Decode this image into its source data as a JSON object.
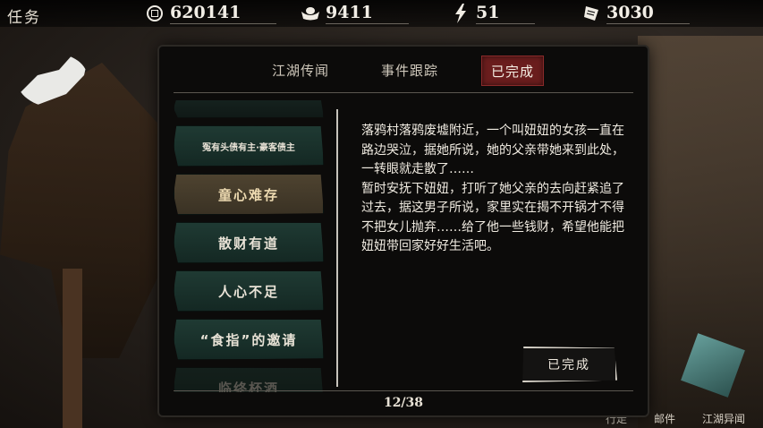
{
  "topbar": {
    "task_label": "任务",
    "resources": [
      {
        "icon": "coin-icon",
        "value": "620141"
      },
      {
        "icon": "silver-ingot-icon",
        "value": "9411"
      },
      {
        "icon": "lightning-icon",
        "value": "51"
      },
      {
        "icon": "scroll-icon",
        "value": "3030"
      }
    ]
  },
  "tabs": [
    {
      "label": "江湖传闻",
      "active": false
    },
    {
      "label": "事件跟踪",
      "active": false
    },
    {
      "label": "已完成",
      "active": true
    }
  ],
  "quest_list": [
    {
      "label": "冤有头债有主·豪客债主",
      "state": "normal"
    },
    {
      "label": "童心难存",
      "state": "active"
    },
    {
      "label": "散财有道",
      "state": "normal"
    },
    {
      "label": "人心不足",
      "state": "normal"
    },
    {
      "label": "“食指”的邀请",
      "state": "normal"
    },
    {
      "label": "临终杯酒",
      "state": "faded"
    }
  ],
  "description": "落鸦村落鸦废墟附近，一个叫妞妞的女孩一直在路边哭泣，据她所说，她的父亲带她来到此处，一转眼就走散了……\n暂时安抚下妞妞，打听了她父亲的去向赶紧追了过去，据这男子所说，家里实在揭不开锅才不得不把女儿抛弃……给了他一些钱财，希望他能把妞妞带回家好好生活吧。",
  "status_button": "已完成",
  "pagination": "12/38",
  "background_labels": [
    "行走",
    "邮件",
    "江湖异闻"
  ]
}
